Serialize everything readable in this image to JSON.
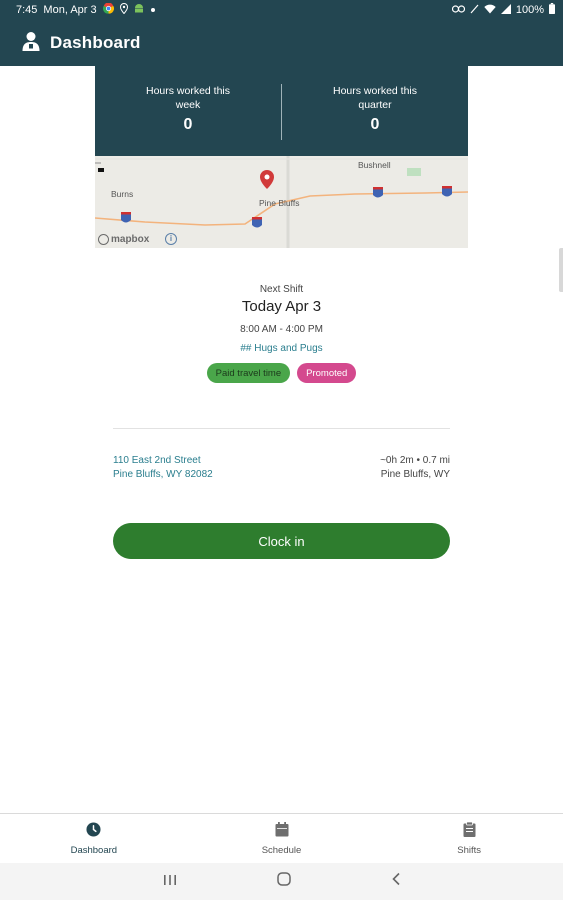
{
  "status_bar": {
    "time": "7:45",
    "date": "Mon, Apr 3",
    "battery": "100%",
    "icons": [
      "chrome-icon",
      "location-icon",
      "android-icon",
      "dot-icon",
      "link-icon",
      "no-sim-icon",
      "wifi-icon",
      "signal-icon",
      "battery-icon"
    ]
  },
  "app_bar": {
    "title": "Dashboard",
    "icon": "user-badge-icon"
  },
  "stats": [
    {
      "label": "Hours worked this week",
      "value": "0"
    },
    {
      "label": "Hours worked this quarter",
      "value": "0"
    }
  ],
  "map": {
    "places": [
      "Bushnell",
      "Burns",
      "Pine Bluffs"
    ],
    "attribution": "mapbox",
    "marker_color": "#d13a3a"
  },
  "next_shift": {
    "label": "Next Shift",
    "date": "Today Apr 3",
    "time": "8:00 AM - 4:00 PM",
    "organization": "## Hugs and Pugs",
    "badges": [
      {
        "label": "Paid travel time",
        "color": "#4aa64a"
      },
      {
        "label": "Promoted",
        "color": "#d4498e"
      }
    ]
  },
  "location": {
    "street": "110 East 2nd Street",
    "city": "Pine Bluffs, WY 82082",
    "travel": "~0h 2m • 0.7 mi",
    "travel_city": "Pine Bluffs, WY"
  },
  "clock_in_label": "Clock in",
  "bottom_nav": [
    {
      "label": "Dashboard",
      "icon": "clock-icon",
      "active": true
    },
    {
      "label": "Schedule",
      "icon": "calendar-icon",
      "active": false
    },
    {
      "label": "Shifts",
      "icon": "clipboard-icon",
      "active": false
    }
  ],
  "colors": {
    "primary": "#234651",
    "accent_green": "#2e7d2e",
    "link": "#2a7e8e"
  }
}
